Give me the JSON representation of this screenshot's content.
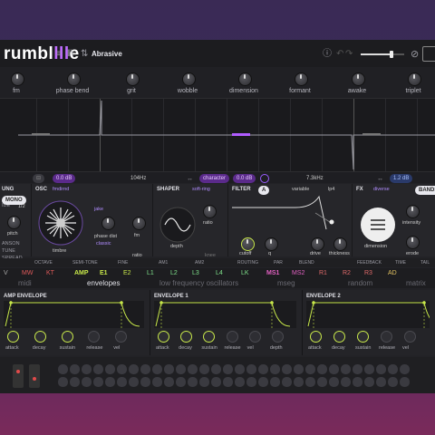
{
  "app": {
    "logo_prefix": "rumbl",
    "logo_accent": "lll",
    "logo_suffix": "e",
    "preset": "Abrasive"
  },
  "macros": [
    {
      "label": "fm"
    },
    {
      "label": "phase bend"
    },
    {
      "label": "grit"
    },
    {
      "label": "wobble"
    },
    {
      "label": "dimension"
    },
    {
      "label": "formant"
    },
    {
      "label": "awake"
    },
    {
      "label": "triplet"
    }
  ],
  "strip": {
    "db1": "0.0 dB",
    "freq": "104Hz",
    "character": "character",
    "db2": "0.0 dB",
    "freq2": "7.3kHz",
    "db3": "1.2 dB"
  },
  "osc": {
    "title": "OSC",
    "mode": "fmdirnd",
    "sub": "jake",
    "timbre": "timbre",
    "phase": "phase dist",
    "classic": "classic",
    "fm": "fm",
    "ratio": "ratio",
    "pitch": "pitch",
    "mono": "MONO",
    "val": "1/2",
    "list": [
      "ANSON",
      "TUNE",
      "SPREAD"
    ],
    "left_labels": [
      "UNG",
      "IDE"
    ]
  },
  "shaper": {
    "title": "SHAPER",
    "mode": "soft-ring",
    "depth": "depth",
    "ratio": "ratio",
    "knee": "knee"
  },
  "filter": {
    "title": "FILTER",
    "a": "A",
    "mode": "variable",
    "type": "lp4",
    "cutoff": "cutoff",
    "q": "q",
    "drive": "drive",
    "thickness": "thickness"
  },
  "fx": {
    "title": "FX",
    "mode": "diverse",
    "band": "BANDS",
    "dimension": "dimension",
    "intensity": "intensity",
    "erode": "erode"
  },
  "params": [
    "OCTAVE",
    "SEMI-TONE",
    "FINE",
    "AM1",
    "AM2",
    "ROUTING",
    "PAR",
    "BLEND",
    "FEEDBACK",
    "TIME",
    "TAIL"
  ],
  "tabs": {
    "items": [
      "V",
      "MW",
      "KT",
      "AMP",
      "E1",
      "E2",
      "L1",
      "L2",
      "L3",
      "L4",
      "LK",
      "MS1",
      "MS2",
      "R1",
      "R2",
      "R3",
      "AD"
    ],
    "groups": [
      "midi",
      "envelopes",
      "low frequency oscillators",
      "mseg",
      "random",
      "matrix"
    ]
  },
  "envs": [
    {
      "title": "AMP ENVELOPE",
      "labels": [
        "attack",
        "decay",
        "sustain",
        "release",
        "vel"
      ]
    },
    {
      "title": "ENVELOPE 1",
      "labels": [
        "attack",
        "decay",
        "sustain",
        "release",
        "vel",
        "depth"
      ]
    },
    {
      "title": "ENVELOPE 2",
      "labels": [
        "attack",
        "decay",
        "sustain",
        "release",
        "vel"
      ]
    }
  ],
  "colors": {
    "accent": "#b05cff",
    "env": "#c8e84a",
    "mw": "#e05a5a",
    "green": "#7ee08a",
    "blue": "#6a8cff",
    "pink": "#e060c0"
  }
}
